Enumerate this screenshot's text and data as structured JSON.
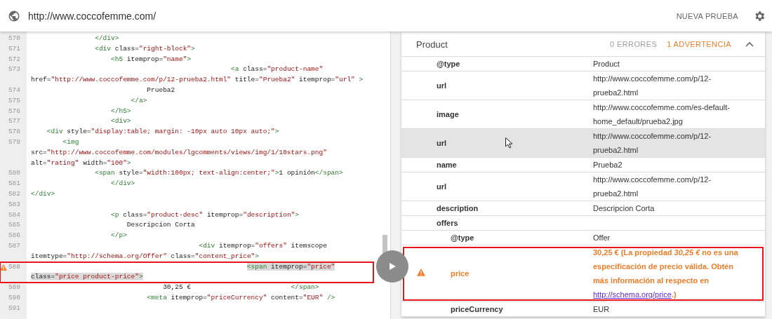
{
  "address_bar": {
    "url": "http://www.coccofemme.com/"
  },
  "toolbar": {
    "new_test_button": "NUEVA PRUEBA"
  },
  "code": {
    "lines": [
      {
        "number": "570",
        "segments": [
          "                </div>"
        ],
        "highlighted": false,
        "warning": false,
        "annotated": false
      },
      {
        "number": "571",
        "segments": [
          "                <div class=\"right-block\">"
        ],
        "highlighted": false,
        "warning": false,
        "annotated": false
      },
      {
        "number": "572",
        "segments": [
          "                    <h5 itemprop=\"name\">"
        ],
        "highlighted": false,
        "warning": false,
        "annotated": false
      },
      {
        "number": "573",
        "segments": [
          "                                                  <a class=\"product-name\"",
          "href=\"http://www.coccofemme.com/p/12-prueba2.html\" title=\"Prueba2\" itemprop=\"url\" >"
        ],
        "highlighted": false,
        "warning": false,
        "annotated": false
      },
      {
        "number": "574",
        "segments": [
          "                             Prueba2"
        ],
        "highlighted": false,
        "warning": false,
        "annotated": false
      },
      {
        "number": "575",
        "segments": [
          "                         </a>"
        ],
        "highlighted": false,
        "warning": false,
        "annotated": false
      },
      {
        "number": "576",
        "segments": [
          "                    </h5>"
        ],
        "highlighted": false,
        "warning": false,
        "annotated": false
      },
      {
        "number": "577",
        "segments": [
          "                    <div>"
        ],
        "highlighted": false,
        "warning": false,
        "annotated": false
      },
      {
        "number": "578",
        "segments": [
          "    <div style=\"display:table; margin: -10px auto 10px auto;\">"
        ],
        "highlighted": false,
        "warning": false,
        "annotated": false
      },
      {
        "number": "579",
        "segments": [
          "        <img",
          "src=\"http://www.coccofemme.com/modules/lgcomments/views/img/1/10stars.png\"",
          "alt=\"rating\" width=\"100\">"
        ],
        "highlighted": false,
        "warning": false,
        "annotated": false
      },
      {
        "number": "580",
        "segments": [
          "                <span style=\"width:100px; text-align:center;\">1 opinión</span>"
        ],
        "highlighted": false,
        "warning": false,
        "annotated": false
      },
      {
        "number": "581",
        "segments": [
          "                    </div>"
        ],
        "highlighted": false,
        "warning": false,
        "annotated": false
      },
      {
        "number": "582",
        "segments": [
          "</div>"
        ],
        "highlighted": false,
        "warning": false,
        "annotated": false
      },
      {
        "number": "583",
        "highlighted": false,
        "warning": false,
        "annotated": false
      },
      {
        "number": "584",
        "segments": [
          "                    <p class=\"product-desc\" itemprop=\"description\">"
        ],
        "highlighted": false,
        "warning": false,
        "annotated": false
      },
      {
        "number": "585",
        "segments": [
          "                        Descripcion Corta"
        ],
        "highlighted": false,
        "warning": false,
        "annotated": false
      },
      {
        "number": "586",
        "segments": [
          "                    </p>"
        ],
        "highlighted": false,
        "warning": false,
        "annotated": false
      },
      {
        "number": "587",
        "segments": [
          "                                          <div itemprop=\"offers\" itemscope",
          "itemtype=\"http://schema.org/Offer\" class=\"content_price\">"
        ],
        "highlighted": false,
        "warning": false,
        "annotated": false
      },
      {
        "number": "588",
        "segments": [
          "                                                      <span itemprop=\"price\"",
          "class=\"price product-price\">"
        ],
        "highlighted": true,
        "warning": true,
        "annotated": true
      },
      {
        "number": "589",
        "segments": [
          [
            "                                 30,25 €",
            "                         </span>"
          ]
        ],
        "highlighted": false,
        "warning": false,
        "annotated": false
      },
      {
        "number": "590",
        "segments": [
          "                             <meta itemprop=\"priceCurrency\" content=\"EUR\" />"
        ],
        "highlighted": false,
        "warning": false,
        "annotated": false
      },
      {
        "number": "591",
        "highlighted": false,
        "warning": false,
        "annotated": false
      }
    ]
  },
  "results": {
    "title": "Product",
    "errors": "0 ERRORES",
    "warnings": "1 ADVERTENCIA",
    "expanded": true,
    "properties": [
      {
        "name": "@type",
        "kind": "plain",
        "value": [
          "Product"
        ],
        "hovered": false
      },
      {
        "name": "url",
        "kind": "plain",
        "value": [
          "http://www.coccofemme.com/p/12-",
          "prueba2.html"
        ],
        "hovered": false
      },
      {
        "name": "image",
        "kind": "plain",
        "value": [
          "http://www.coccofemme.com/es-default-",
          "home_default/prueba2.jpg"
        ],
        "hovered": false
      },
      {
        "name": "url",
        "kind": "plain",
        "value": [
          "http://www.coccofemme.com/p/12-",
          "prueba2.html"
        ],
        "hovered": true
      },
      {
        "name": "name",
        "kind": "plain",
        "value": [
          "Prueba2"
        ],
        "hovered": false
      },
      {
        "name": "url",
        "kind": "plain",
        "value": [
          "http://www.coccofemme.com/p/12-",
          "prueba2.html"
        ],
        "hovered": false
      },
      {
        "name": "description",
        "kind": "plain",
        "value": [
          "Descripcion Corta"
        ],
        "hovered": false
      },
      {
        "name": "offers",
        "kind": "group",
        "hovered": false,
        "children": [
          {
            "name": "@type",
            "kind": "plain",
            "value": [
              "Offer"
            ],
            "hovered": false
          },
          {
            "name": "price",
            "kind": "warning",
            "message": "30,25 € (La propiedad *30,25 €* no es una especificación de precio válida. Obtén más información al respecto en ",
            "link": "http://schema.org/price",
            "suffix": ".)",
            "hovered": false,
            "annotated": true
          },
          {
            "name": "priceCurrency",
            "kind": "plain",
            "value": [
              "EUR"
            ],
            "hovered": false
          }
        ]
      }
    ]
  }
}
